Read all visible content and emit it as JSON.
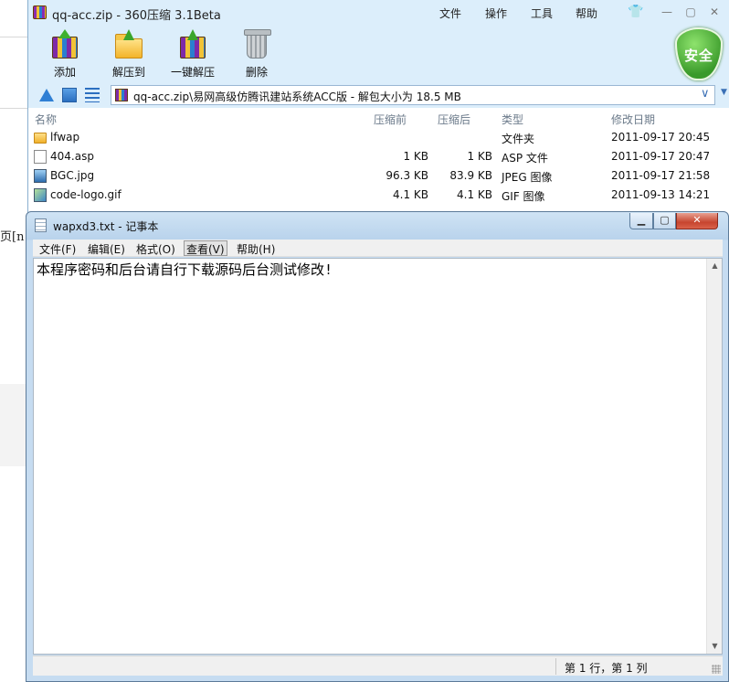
{
  "background": {
    "fragment_text": "页[n"
  },
  "zip_window": {
    "title": "qq-acc.zip - 360压缩 3.1Beta",
    "menus": [
      "文件",
      "操作",
      "工具",
      "帮助"
    ],
    "toolbar": [
      {
        "label": "添加",
        "icon": "add-archive-icon"
      },
      {
        "label": "解压到",
        "icon": "extract-to-icon"
      },
      {
        "label": "一键解压",
        "icon": "one-click-extract-icon"
      },
      {
        "label": "删除",
        "icon": "delete-icon"
      }
    ],
    "badge": "安全",
    "address": "qq-acc.zip\\易网高级仿腾讯建站系统ACC版 - 解包大小为 18.5 MB",
    "columns": [
      "名称",
      "压缩前",
      "压缩后",
      "类型",
      "修改日期"
    ],
    "rows": [
      {
        "name": "lfwap",
        "before": "",
        "after": "",
        "type": "文件夹",
        "date": "2011-09-17 20:45",
        "icon": "folder"
      },
      {
        "name": "404.asp",
        "before": "1 KB",
        "after": "1 KB",
        "type": "ASP 文件",
        "date": "2011-09-17 20:47",
        "icon": "doc"
      },
      {
        "name": "BGC.jpg",
        "before": "96.3 KB",
        "after": "83.9 KB",
        "type": "JPEG 图像",
        "date": "2011-09-17 21:58",
        "icon": "img"
      },
      {
        "name": "code-logo.gif",
        "before": "4.1 KB",
        "after": "4.1 KB",
        "type": "GIF 图像",
        "date": "2011-09-13 14:21",
        "icon": "gif"
      }
    ]
  },
  "notepad": {
    "title": "wapxd3.txt - 记事本",
    "menus": [
      "文件(F)",
      "编辑(E)",
      "格式(O)",
      "查看(V)",
      "帮助(H)"
    ],
    "active_menu": "查看(V)",
    "content": "本程序密码和后台请自行下载源码后台测试修改!",
    "status": "第 1 行，第 1 列"
  }
}
